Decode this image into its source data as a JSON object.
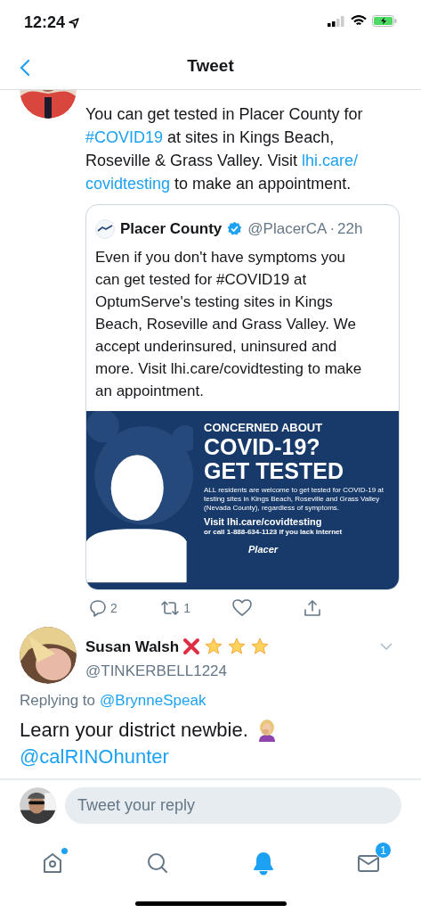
{
  "status_bar": {
    "time": "12:24"
  },
  "nav": {
    "title": "Tweet"
  },
  "tweet": {
    "segments": [
      {
        "kind": "text",
        "text": "You can get tested in Placer County for "
      },
      {
        "kind": "link",
        "text": "#COVID19"
      },
      {
        "kind": "text",
        "text": " at sites in Kings Beach, Roseville & Grass Valley. Visit "
      },
      {
        "kind": "link",
        "text": "lhi.care/"
      },
      {
        "kind": "link",
        "text": "covidtesting"
      },
      {
        "kind": "text",
        "text": " to make an appointment."
      }
    ],
    "quote": {
      "name": "Placer County",
      "verified": true,
      "handle": "@PlacerCA",
      "separator": "·",
      "time": "22h",
      "text": "Even if you don't have symptoms you can get tested for #COVID19 at OptumServe's testing sites in Kings Beach, Roseville and Grass Valley. We accept underinsured, uninsured and more. Visit lhi.care/covidtesting to make an appointment.",
      "graphic": {
        "kicker": "CONCERNED ABOUT",
        "headline_1": "COVID-19?",
        "headline_2": "GET TESTED",
        "body": "ALL residents are welcome to get tested for COVID-19 at testing sites in Kings Beach, Roseville and Grass Valley (Nevada County), regardless of symptoms.",
        "cta": "Visit lhi.care/covidtesting",
        "call": "or call 1-888-634-1123 if you lack internet",
        "logo": "Placer"
      }
    },
    "actions": [
      {
        "kind": "reply",
        "count": "2"
      },
      {
        "kind": "retweet",
        "count": "1"
      },
      {
        "kind": "like"
      },
      {
        "kind": "share"
      }
    ]
  },
  "reply": {
    "name": "Susan Walsh",
    "handle": "@TINKERBELL1224",
    "replying_label": "Replying to",
    "replying_to": "@BrynneSpeak",
    "text": "Learn your district newbie.",
    "mention": "@calRINOhunter"
  },
  "composer": {
    "placeholder": "Tweet your reply"
  },
  "tabs": [
    {
      "kind": "home",
      "selected": false,
      "dot": true
    },
    {
      "kind": "search",
      "selected": false
    },
    {
      "kind": "notifications",
      "selected": true
    },
    {
      "kind": "messages",
      "selected": false,
      "badge": "1"
    }
  ]
}
